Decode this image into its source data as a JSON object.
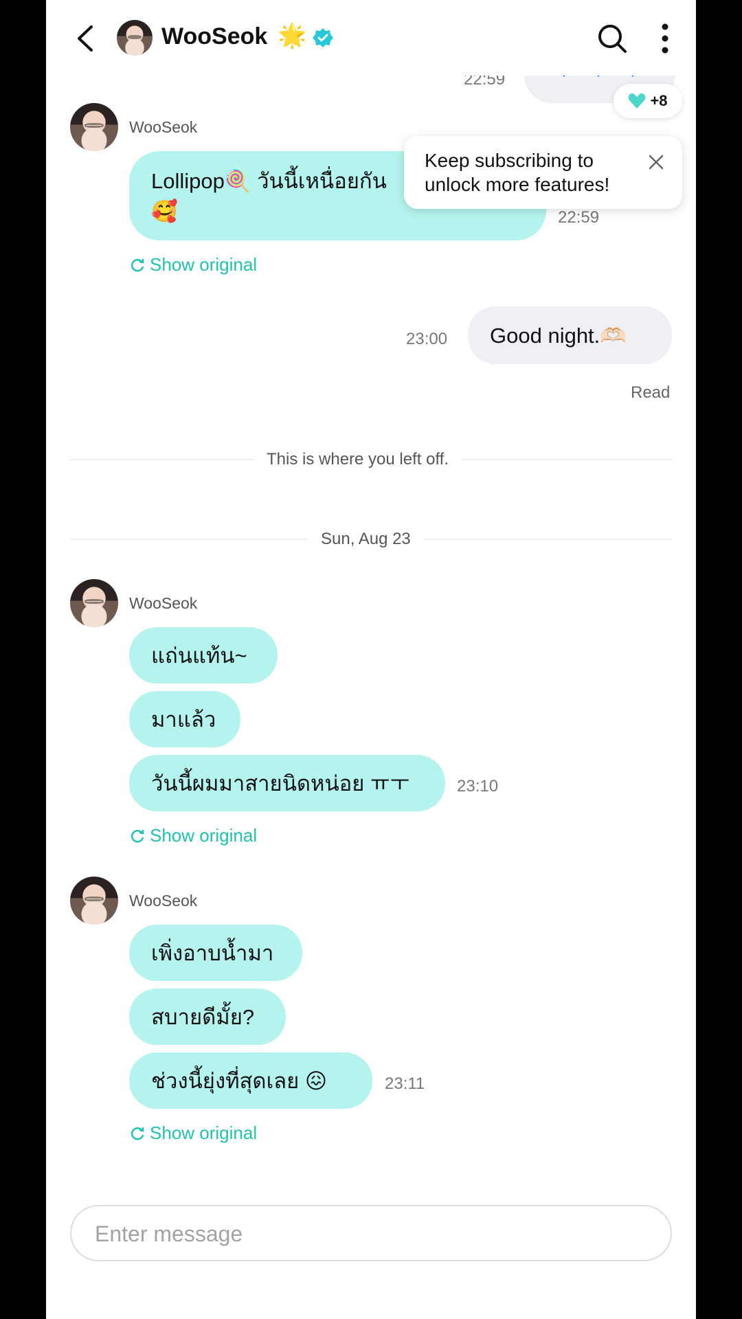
{
  "header": {
    "title": "WooSeok",
    "star_emoji": "🌟",
    "icons": [
      "back-icon",
      "search-icon",
      "more-icon",
      "verified-icon"
    ]
  },
  "top_message": {
    "time": "22:59",
    "reaction_count": "+8",
    "reaction_color": "#4fd6c8"
  },
  "tooltip": {
    "text_line1": "Keep subscribing to",
    "text_line2": "unlock more features!"
  },
  "messages": {
    "block1": {
      "sender": "WooSeok",
      "line1": "Lollipop🍭 วันนี้เหนื่อยกัน",
      "line2": "🥰",
      "time": "22:59",
      "show_original": "Show original"
    },
    "mine": {
      "text": "Good night.🫶🏻",
      "time": "23:00",
      "status": "Read"
    },
    "left_off": "This is where you left off.",
    "date": "Sun, Aug 23",
    "block2": {
      "sender": "WooSeok",
      "bubbles": [
        "แถ่นแท้น~",
        "มาแล้ว",
        "วันนี้ผมมาสายนิดหน่อย ㅠㅜ"
      ],
      "time": "23:10",
      "show_original": "Show original"
    },
    "block3": {
      "sender": "WooSeok",
      "bubbles": [
        "เพิ่งอาบน้ำมา",
        "สบายดีมั้ย?",
        "ช่วงนี้ยุ่งที่สุดเลย 😖"
      ],
      "time": "23:11",
      "show_original": "Show original"
    }
  },
  "composer": {
    "placeholder": "Enter message"
  },
  "colors": {
    "bubble_artist": "#b5f4ee",
    "bubble_me": "#eef0f3",
    "accent": "#1fc2b0"
  }
}
